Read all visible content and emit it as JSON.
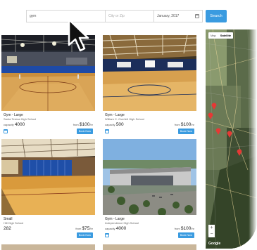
{
  "search": {
    "keyword_value": "gym",
    "city_placeholder": "City or Zip",
    "date_value": "January, 2017",
    "button_label": "Search"
  },
  "cards": [
    {
      "title": "Gym - Large",
      "school": "Santa Teresa High School",
      "capacity_label": "capacity",
      "capacity": "4000",
      "price_prefix": "from",
      "price": "$100",
      "price_unit": "/hr",
      "book_label": "Book Now"
    },
    {
      "title": "Gym - Large",
      "school": "William C. Overfelt High School",
      "capacity_label": "capacity",
      "capacity": "500",
      "price_prefix": "from",
      "price": "$100",
      "price_unit": "/hr",
      "book_label": "Book Now"
    },
    {
      "title": "Small",
      "school": "Hill High School",
      "capacity_label": "",
      "capacity": "282",
      "price_prefix": "from",
      "price": "$75",
      "price_unit": "/hr",
      "book_label": "Book Now"
    },
    {
      "title": "Gym - Large",
      "school": "Independence High School",
      "capacity_label": "capacity",
      "capacity": "4000",
      "price_prefix": "from",
      "price": "$100",
      "price_unit": "/hr",
      "book_label": "Book Now"
    }
  ],
  "map": {
    "tab_map": "Map",
    "tab_satellite": "Satellite",
    "zoom_in": "+",
    "zoom_out": "−",
    "attribution": "Google"
  },
  "icons": {
    "calendar": "calendar-icon",
    "cursor": "cursor-arrow-icon",
    "pin": "map-pin-icon"
  },
  "colors": {
    "accent": "#3a9be0",
    "pin": "#e53935"
  }
}
